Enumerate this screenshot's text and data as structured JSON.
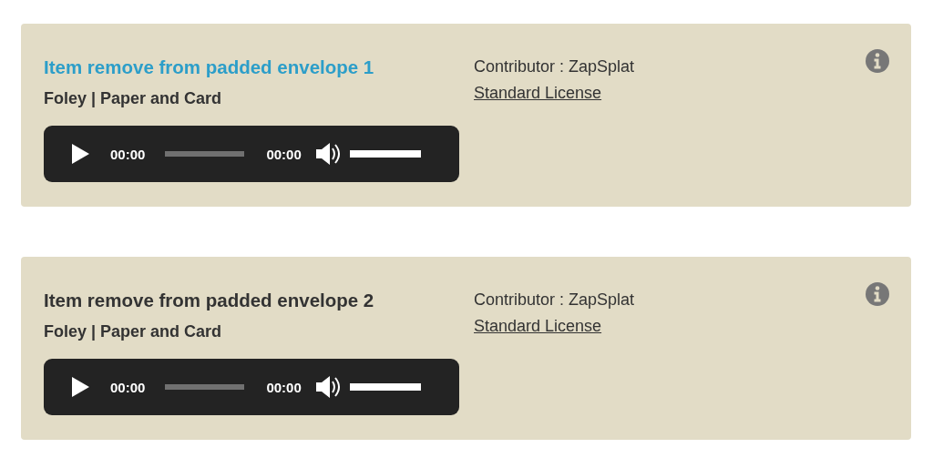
{
  "sounds": [
    {
      "title": "Item remove from padded envelope 1",
      "highlighted": true,
      "category": "Foley | Paper and Card",
      "player": {
        "current_time": "00:00",
        "progress": {
          "level": 0
        },
        "duration": "00:00",
        "volume": {
          "level": 1
        }
      },
      "contributor": "Contributor : ZapSplat",
      "license": "Standard License"
    },
    {
      "title": "Item remove from padded envelope 2",
      "highlighted": false,
      "category": "Foley | Paper and Card",
      "player": {
        "current_time": "00:00",
        "progress": {
          "level": 0
        },
        "duration": "00:00",
        "volume": {
          "level": 1
        }
      },
      "contributor": "Contributor : ZapSplat",
      "license": "Standard License"
    }
  ]
}
